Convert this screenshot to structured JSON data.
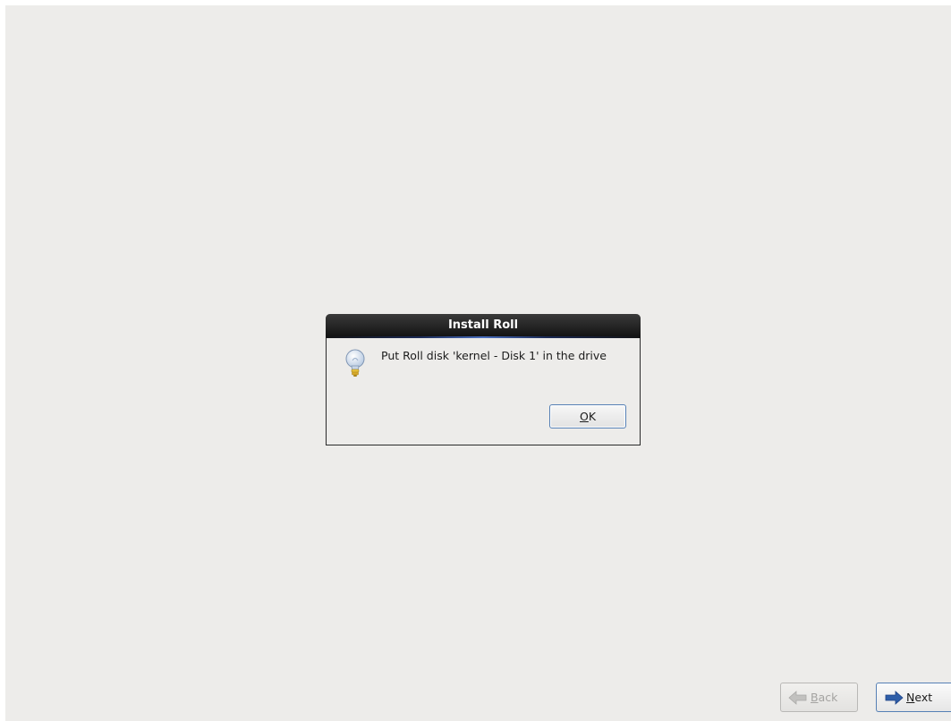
{
  "dialog": {
    "title": "Install Roll",
    "message": "Put Roll disk 'kernel - Disk 1' in the drive",
    "icon": "lightbulb-icon",
    "ok_button": {
      "mnemonic": "O",
      "rest": "K"
    }
  },
  "navigation": {
    "back": {
      "mnemonic": "B",
      "rest": "ack",
      "icon": "arrow-left-icon",
      "enabled": false
    },
    "next": {
      "mnemonic": "N",
      "rest": "ext",
      "icon": "arrow-right-icon",
      "enabled": true
    }
  },
  "colors": {
    "background": "#edecea",
    "titlebar": "#1a1a1a",
    "accent_blue": "#2f5ea8",
    "focus_border": "#5680b5"
  }
}
